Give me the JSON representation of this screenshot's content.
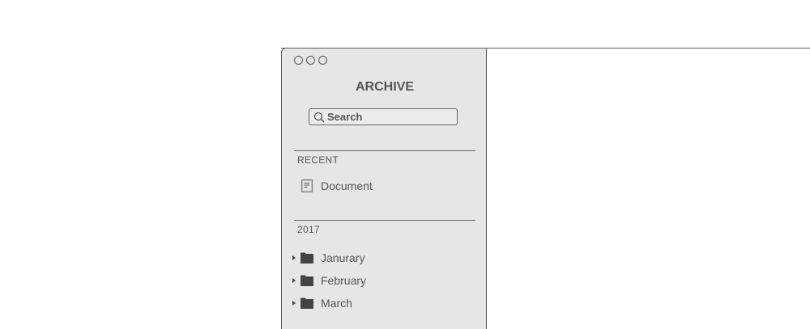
{
  "sidebar": {
    "title": "ARCHIVE",
    "search": {
      "placeholder": "Search"
    },
    "sections": [
      {
        "label": "RECENT",
        "items": [
          {
            "label": "Document",
            "icon": "document-icon"
          }
        ]
      },
      {
        "label": "2017",
        "items": [
          {
            "label": "Janurary",
            "icon": "folder-icon"
          },
          {
            "label": "February",
            "icon": "folder-icon"
          },
          {
            "label": "March",
            "icon": "folder-icon"
          }
        ]
      }
    ]
  },
  "colors": {
    "sidebar_bg": "#e6e6e6",
    "text": "#555555",
    "border": "#5a5a5a"
  }
}
